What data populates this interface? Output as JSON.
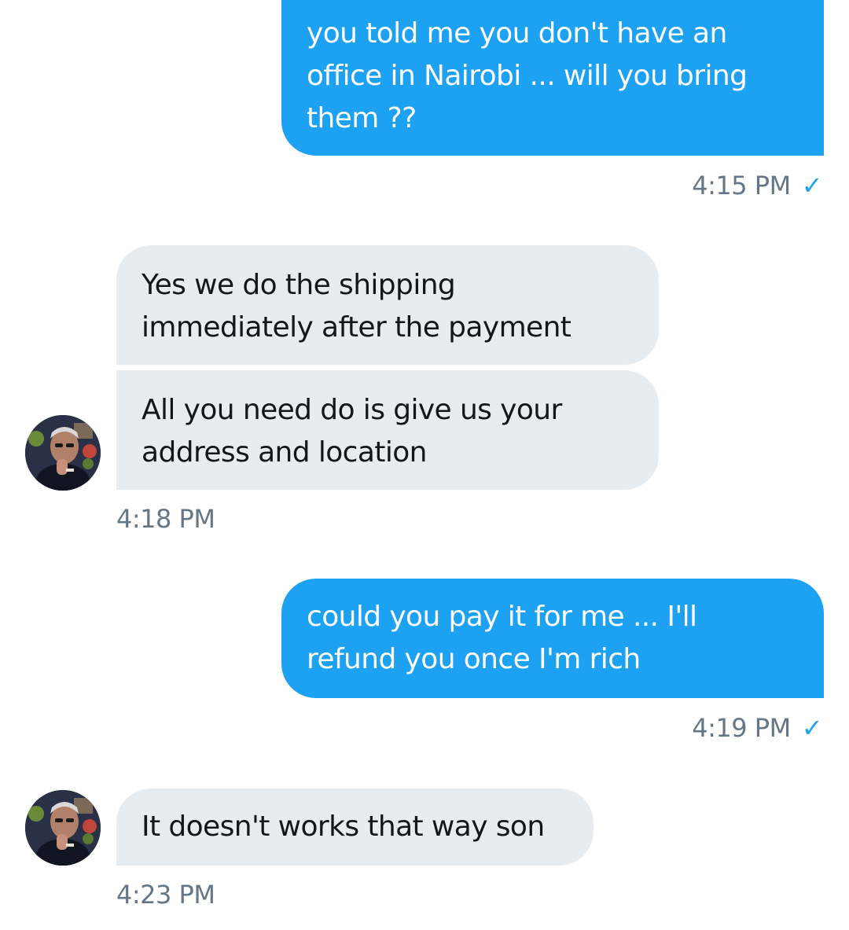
{
  "messages": [
    {
      "direction": "sent",
      "lines": [
        "you told me you don't have an",
        "office in Nairobi ... will you bring",
        "them ??"
      ],
      "time": "4:15 PM",
      "status_icon": "check-icon"
    },
    {
      "direction": "received",
      "lines": [
        "Yes we do the shipping",
        "immediately after the payment"
      ]
    },
    {
      "direction": "received",
      "lines": [
        "All you need do is give us your",
        "address and location"
      ],
      "time": "4:18 PM"
    },
    {
      "direction": "sent",
      "lines": [
        "could you pay it for me ... I'll",
        "refund you once I'm rich"
      ],
      "time": "4:19 PM",
      "status_icon": "check-icon"
    },
    {
      "direction": "received",
      "lines": [
        "It doesn't works that way son"
      ],
      "time": "4:23 PM"
    }
  ],
  "check_glyph": "✓",
  "colors": {
    "sent_bubble": "#1da1f2",
    "received_bubble": "#e6ecf0",
    "timestamp": "#657786",
    "check": "#1da1f2"
  }
}
